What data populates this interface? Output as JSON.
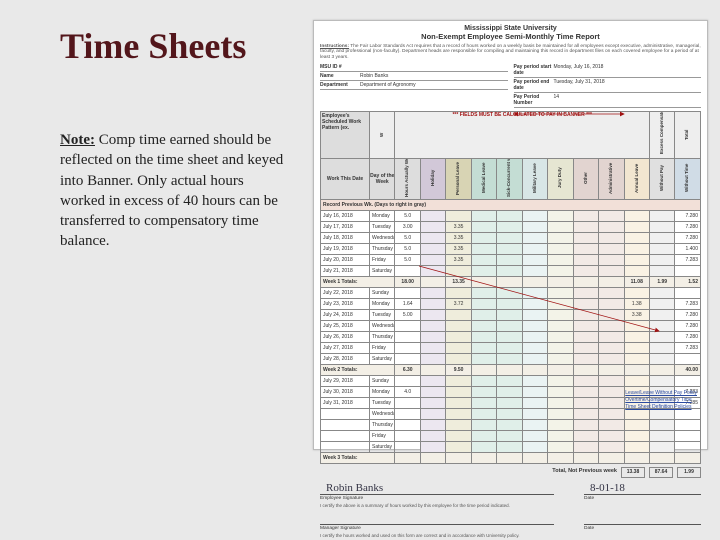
{
  "slide": {
    "title": "Time Sheets",
    "note_label": "Note:",
    "note_body": " Comp time earned should be reflected on the time sheet and keyed into Banner. Only actual hours worked in excess of 40 hours can be transferred to compensatory time balance."
  },
  "doc": {
    "org": "Mississippi State University",
    "form_title": "Non-Exempt Employee Semi-Monthly Time Report",
    "instructions_label": "Instructions:",
    "instructions": " The Fair Labor Standards Act requires that a record of hours worked on a weekly basis be maintained for all employees except executive, administrative, managerial, faculty, and professional (non-faculty). Department heads are responsible for compiling and maintaining this record in department files on each covered employee for a period of at least 3 years.",
    "meta_left": [
      {
        "label": "MSU ID #",
        "value": ""
      },
      {
        "label": "Name",
        "value": "Robin Banks"
      },
      {
        "label": "Department",
        "value": "Department of Agronomy"
      }
    ],
    "meta_right": [
      {
        "label": "Pay period start date",
        "value": "Monday, July 16, 2018"
      },
      {
        "label": "Pay period end date",
        "value": "Tuesday, July 31, 2018"
      },
      {
        "label": "Pay Period Number",
        "value": "14"
      }
    ],
    "columns": {
      "date_hdr": "Employee's Scheduled Work Pattern (ex.",
      "work_date": "Work This Date",
      "dow": "Day of the Week",
      "hours_worked": "Hours Actually Worked",
      "holiday": "Holiday",
      "personal": "Personal Leave",
      "medical": "Medical Leave",
      "sick_fmla": "Sick-Concurrent with FMLA",
      "military": "Military Leave",
      "jury": "Jury Duty",
      "other": "Other",
      "admin": "Administrative",
      "annual": "Annual Leave",
      "wopay": "Without Pay",
      "wotime": "Without Time",
      "comp": "Excess Compensatory Time",
      "total": "Total",
      "red_note": "*** FIELDS MUST BE CALCULATED TO PAY IN BANNER ***"
    },
    "week_header": "Record Previous Wk. (Days to right in gray)",
    "rows": [
      {
        "date": "July 16, 2018",
        "dow": "Monday",
        "hw": "5.0",
        "tot": "7.280"
      },
      {
        "date": "July 17, 2018",
        "dow": "Tuesday",
        "hw": "3.00",
        "pers": "3.35",
        "tot": "7.280"
      },
      {
        "date": "July 18, 2018",
        "dow": "Wednesday",
        "hw": "5.0",
        "pers": "3.35",
        "tot": "7.280"
      },
      {
        "date": "July 19, 2018",
        "dow": "Thursday",
        "hw": "5.0",
        "pers": "3.35",
        "tot": "1.400"
      },
      {
        "date": "July 20, 2018",
        "dow": "Friday",
        "hw": "5.0",
        "pers": "3.35",
        "tot": "7.283"
      },
      {
        "date": "July 21, 2018",
        "dow": "Saturday",
        "tot": ""
      }
    ],
    "week1_totals": {
      "label": "Week 1 Totals:",
      "hw": "18.00",
      "pers": "13.35",
      "ann": "11.08",
      "comp": "1.99",
      "tot": "1.52"
    },
    "rows2": [
      {
        "date": "July 22, 2018",
        "dow": "Sunday",
        "tot": ""
      },
      {
        "date": "July 23, 2018",
        "dow": "Monday",
        "hw": "1.64",
        "pers": "3.72",
        "ann": "1.38",
        "tot": "7.283"
      },
      {
        "date": "July 24, 2018",
        "dow": "Tuesday",
        "hw": "5.00",
        "ann": "3.38",
        "tot": "7.280"
      },
      {
        "date": "July 25, 2018",
        "dow": "Wednesday",
        "tot": "7.280"
      },
      {
        "date": "July 26, 2018",
        "dow": "Thursday",
        "tot": "7.280"
      },
      {
        "date": "July 27, 2018",
        "dow": "Friday",
        "tot": "7.283"
      },
      {
        "date": "July 28, 2018",
        "dow": "Saturday",
        "tot": ""
      }
    ],
    "week2_totals": {
      "label": "Week 2 Totals:",
      "hw": "6.30",
      "pers": "9.50",
      "tot": "40.00"
    },
    "rows3": [
      {
        "date": "July 29, 2018",
        "dow": "Sunday",
        "tot": ""
      },
      {
        "date": "July 30, 2018",
        "dow": "Monday",
        "hw": "4.0",
        "tot": "7.283"
      },
      {
        "date": "July 31, 2018",
        "dow": "Tuesday",
        "tot": "7.285"
      },
      {
        "date": "",
        "dow": "Wednesday"
      },
      {
        "date": "",
        "dow": "Thursday"
      },
      {
        "date": "",
        "dow": "Friday"
      },
      {
        "date": "",
        "dow": "Saturday"
      }
    ],
    "week3_totals": {
      "label": "Week 3 Totals:"
    },
    "grand": {
      "label": "Total, Not Previous week",
      "v1": "13.38",
      "v2": "87.64",
      "v3": "1.99"
    },
    "sig": {
      "name": "Robin Banks",
      "date": "8-01-18",
      "emp_label": "Employee Signature",
      "date_label": "Date"
    },
    "cert1": "I certify the above is a summary of hours worked by this employee for the time period indicated.",
    "mgr_label": "Manager Signature",
    "cert2": "I certify the hours worked and used on this form are correct and in accordance with University policy.",
    "links": [
      "Leave/Leave Without Pay Policy",
      "Overtime/Compensatory Time",
      "Time Sheet Definition Policies"
    ]
  }
}
